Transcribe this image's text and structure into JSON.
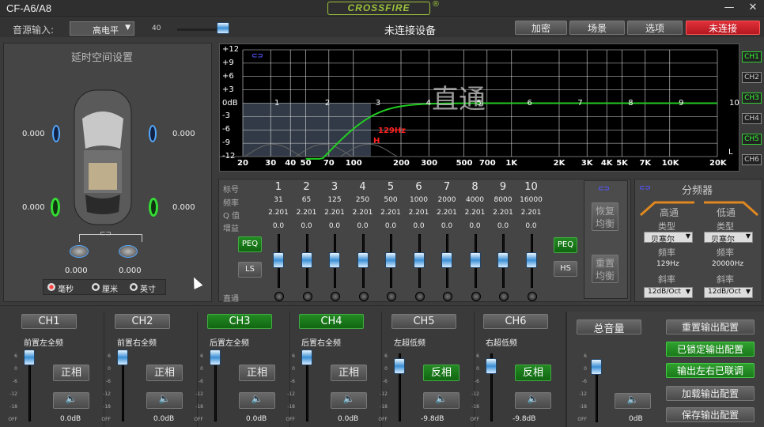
{
  "window": {
    "title": "CF-A6/A8",
    "logo": "CROSSFIRE",
    "logo_mark": "®",
    "min": "—",
    "close": "✕"
  },
  "toolbar": {
    "source_label": "音源输入:",
    "source_value": "高电平",
    "volume_value": "40",
    "status": "未连接设备",
    "buttons": [
      "加密",
      "场景",
      "选项",
      "未连接"
    ]
  },
  "delay": {
    "title": "延时空间设置",
    "values": [
      "0.000",
      "0.000",
      "0.000",
      "0.000",
      "0.000",
      "0.000"
    ],
    "link": "⊂⊃",
    "units": [
      "毫秒",
      "厘米",
      "英寸"
    ]
  },
  "graph": {
    "y_ticks": [
      "+12",
      "+9",
      "+6",
      "+3",
      "0dB",
      "-3",
      "-6",
      "-9",
      "-12"
    ],
    "x_ticks": [
      "20",
      "30",
      "40",
      "50",
      "70",
      "100",
      "200",
      "300",
      "500",
      "700",
      "1K",
      "2K",
      "3K",
      "4K",
      "5K",
      "7K",
      "10K",
      "20K"
    ],
    "watermark": "直通",
    "band_labels": [
      "1",
      "2",
      "3",
      "4",
      "5",
      "6",
      "7",
      "8",
      "9",
      "10"
    ],
    "marker": "129Hz",
    "marker2": "H",
    "corner": "L",
    "link": "⊂⊃"
  },
  "channels_side": [
    "CH1",
    "CH2",
    "CH3",
    "CH4",
    "CH5",
    "CH6"
  ],
  "eq": {
    "row_labels": [
      "标号",
      "频率",
      "Q 值",
      "增益"
    ],
    "numbers": [
      "1",
      "2",
      "3",
      "4",
      "5",
      "6",
      "7",
      "8",
      "9",
      "10"
    ],
    "freqs": [
      "31",
      "65",
      "125",
      "250",
      "500",
      "1000",
      "2000",
      "4000",
      "8000",
      "16000"
    ],
    "q": [
      "2.201",
      "2.201",
      "2.201",
      "2.201",
      "2.201",
      "2.201",
      "2.201",
      "2.201",
      "2.201",
      "2.201"
    ],
    "gain": [
      "0.0",
      "0.0",
      "0.0",
      "0.0",
      "0.0",
      "0.0",
      "0.0",
      "0.0",
      "0.0",
      "0.0"
    ],
    "bypass": "直通",
    "peq_left": "PEQ",
    "ls": "LS",
    "peq_right": "PEQ",
    "hs": "HS",
    "restore": "恢复均衡",
    "reset": "重置均衡",
    "link": "⊂⊃"
  },
  "crossover": {
    "title": "分频器",
    "hp": "高通",
    "lp": "低通",
    "type_label": "类型",
    "hp_type": "贝塞尔",
    "lp_type": "贝塞尔",
    "freq_label": "频率",
    "hp_freq": "129Hz",
    "lp_freq": "20000Hz",
    "slope_label": "斜率",
    "hp_slope": "12dB/Oct",
    "lp_slope": "12dB/Oct",
    "link": "⊂⊃"
  },
  "out_channels": [
    {
      "name": "CH1",
      "label": "前置左全频",
      "phase": "正相",
      "db": "0.0dB",
      "level": 1.0,
      "active": false,
      "invert": false
    },
    {
      "name": "CH2",
      "label": "前置右全频",
      "phase": "正相",
      "db": "0.0dB",
      "level": 1.0,
      "active": false,
      "invert": false
    },
    {
      "name": "CH3",
      "label": "后置左全频",
      "phase": "正相",
      "db": "0.0dB",
      "level": 1.0,
      "active": true,
      "invert": false
    },
    {
      "name": "CH4",
      "label": "后置右全频",
      "phase": "正相",
      "db": "0.0dB",
      "level": 1.0,
      "active": true,
      "invert": false
    },
    {
      "name": "CH5",
      "label": "左超低频",
      "phase": "反相",
      "db": "-9.8dB",
      "level": 0.83,
      "active": false,
      "invert": true
    },
    {
      "name": "CH6",
      "label": "右超低频",
      "phase": "反相",
      "db": "-9.8dB",
      "level": 0.83,
      "active": false,
      "invert": true
    }
  ],
  "master": {
    "label": "总音量",
    "db": "0dB",
    "scale": [
      "6",
      "0",
      "-6",
      "-12",
      "-18",
      "OFF"
    ]
  },
  "config": [
    "重置输出配置",
    "已锁定输出配置",
    "输出左右已联调",
    "加载输出配置",
    "保存输出配置"
  ],
  "fader_scale": [
    "6",
    "0",
    "-6",
    "-12",
    "-18",
    "OFF"
  ],
  "colors": {
    "green": "#2c9a2c",
    "red": "#d42a34",
    "curve": "#22cc22",
    "accent": "#9bc23a"
  }
}
